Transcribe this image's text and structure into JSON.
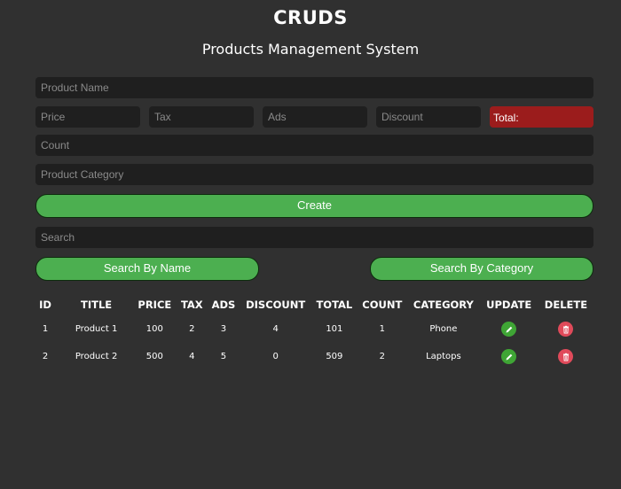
{
  "header": {
    "title": "CRUDS",
    "subtitle": "Products Management System"
  },
  "form": {
    "product_name_placeholder": "Product Name",
    "price_placeholder": "Price",
    "tax_placeholder": "Tax",
    "ads_placeholder": "Ads",
    "discount_placeholder": "Discount",
    "total_label": "Total:",
    "count_placeholder": "Count",
    "category_placeholder": "Product Category",
    "create_label": "Create",
    "search_placeholder": "Search",
    "search_by_name_label": "Search By Name",
    "search_by_category_label": "Search By Category"
  },
  "table": {
    "headers": [
      "ID",
      "TITLE",
      "PRICE",
      "TAX",
      "ADS",
      "DISCOUNT",
      "TOTAL",
      "COUNT",
      "CATEGORY",
      "UPDATE",
      "DELETE"
    ],
    "rows": [
      {
        "id": "1",
        "title": "Product 1",
        "price": "100",
        "tax": "2",
        "ads": "3",
        "discount": "4",
        "total": "101",
        "count": "1",
        "category": "Phone"
      },
      {
        "id": "2",
        "title": "Product 2",
        "price": "500",
        "tax": "4",
        "ads": "5",
        "discount": "0",
        "total": "509",
        "count": "2",
        "category": "Laptops"
      }
    ]
  },
  "colors": {
    "background": "#303030",
    "input_bg": "#1f1f1f",
    "button_green": "#4caf50",
    "total_red": "#9b1c1c",
    "update_icon_green": "#3fa535",
    "delete_icon_red": "#e04a5a"
  },
  "icons": {
    "update": "pencil-icon",
    "delete": "trash-icon"
  }
}
